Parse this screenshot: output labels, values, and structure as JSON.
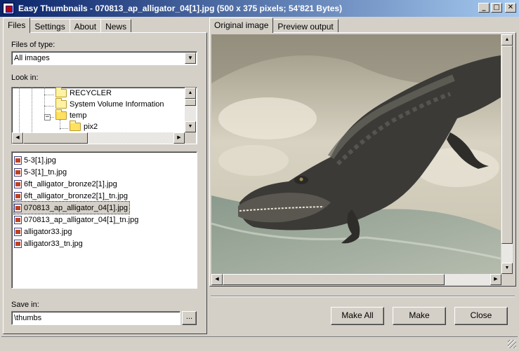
{
  "window": {
    "title": "Easy Thumbnails - 070813_ap_alligator_04[1].jpg",
    "image_info": "(500 x 375 pixels;  54'821 Bytes)",
    "minimize_glyph": "_",
    "maximize_glyph": "□",
    "close_glyph": "✕"
  },
  "left_tabs": [
    {
      "label": "Files",
      "active": true
    },
    {
      "label": "Settings",
      "active": false
    },
    {
      "label": "About",
      "active": false
    },
    {
      "label": "News",
      "active": false
    }
  ],
  "right_tabs": [
    {
      "label": "Original image",
      "active": true
    },
    {
      "label": "Preview output",
      "active": false
    }
  ],
  "files_of_type": {
    "label": "Files of type:",
    "value": "All images"
  },
  "look_in": {
    "label": "Look in:",
    "tree": [
      {
        "name": "RECYCLER",
        "expanded": false
      },
      {
        "name": "System Volume Information",
        "expanded": false
      },
      {
        "name": "temp",
        "expanded": true
      },
      {
        "name": "pix2",
        "expanded": false
      }
    ]
  },
  "file_list": [
    {
      "name": "5-3[1].jpg",
      "selected": false
    },
    {
      "name": "5-3[1]_tn.jpg",
      "selected": false
    },
    {
      "name": "6ft_alligator_bronze2[1].jpg",
      "selected": false
    },
    {
      "name": "6ft_alligator_bronze2[1]_tn.jpg",
      "selected": false
    },
    {
      "name": "070813_ap_alligator_04[1].jpg",
      "selected": true
    },
    {
      "name": "070813_ap_alligator_04[1]_tn.jpg",
      "selected": false
    },
    {
      "name": "alligator33.jpg",
      "selected": false
    },
    {
      "name": "alligator33_tn.jpg",
      "selected": false
    }
  ],
  "save_in": {
    "label": "Save in:",
    "value": "\\thumbs",
    "browse_label": "..."
  },
  "buttons": {
    "make_all": "Make All",
    "make": "Make",
    "close": "Close"
  },
  "image": {
    "subject": "alligator-photo"
  },
  "colors": {
    "title_start": "#0a246a",
    "title_end": "#a6caf0",
    "face": "#d4d0c8"
  }
}
